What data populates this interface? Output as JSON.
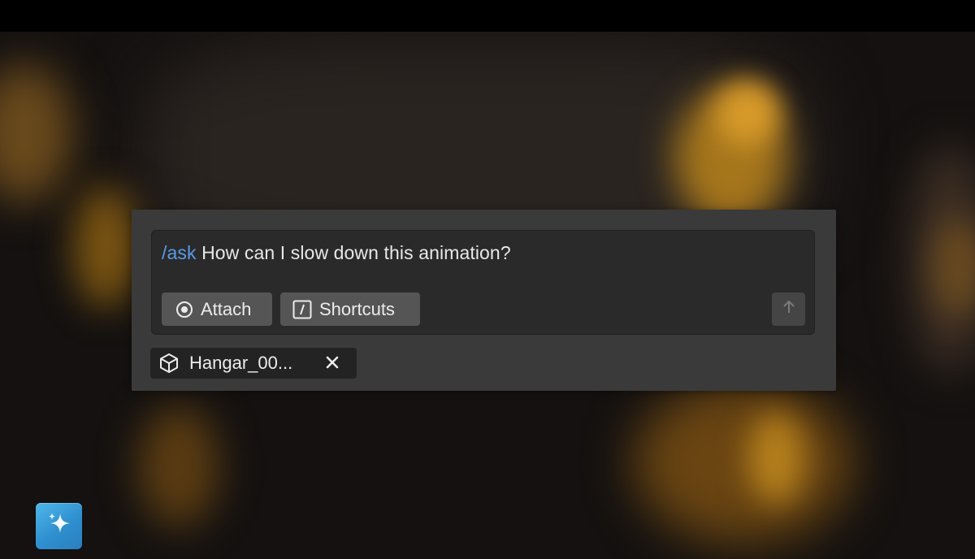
{
  "prompt": {
    "command": "/ask",
    "text": " How can I slow down this animation?"
  },
  "buttons": {
    "attach_label": "Attach",
    "shortcuts_label": "Shortcuts"
  },
  "icons": {
    "attach": "radio-target-icon",
    "shortcuts": "slash-key-icon",
    "send": "arrow-up-icon",
    "asset": "cube-icon",
    "remove": "close-icon",
    "assistant": "sparkle-icon"
  },
  "attachment": {
    "label": "Hangar_00..."
  },
  "colors": {
    "command_accent": "#5a9be6",
    "assistant_button": "#3a9ddc"
  }
}
